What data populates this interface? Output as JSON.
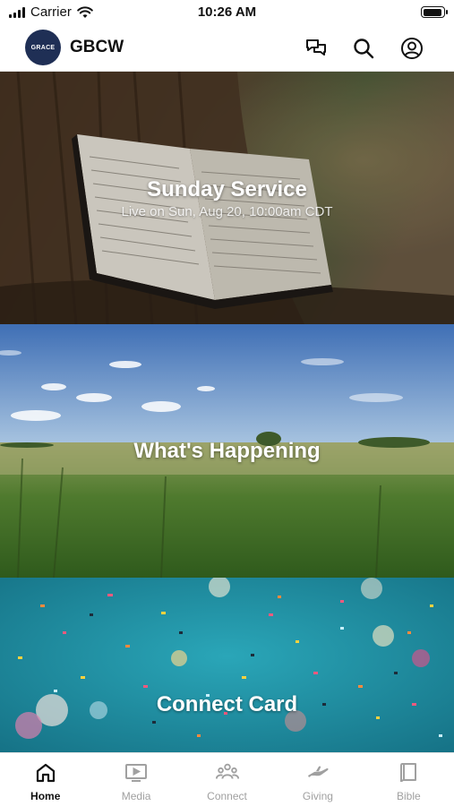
{
  "status_bar": {
    "carrier": "Carrier",
    "time": "10:26 AM"
  },
  "header": {
    "logo_text": "GRACE",
    "title": "GBCW",
    "icons": [
      "chat-icon",
      "search-icon",
      "account-icon"
    ]
  },
  "cards": [
    {
      "title": "Sunday Service",
      "subtitle": "Live on Sun, Aug 20, 10:00am CDT",
      "image": "open-bible-on-tree-stump"
    },
    {
      "title": "What's Happening",
      "image": "green-field-under-blue-sky"
    },
    {
      "title": "Connect Card",
      "image": "confetti-on-teal"
    }
  ],
  "tabs": [
    {
      "label": "Home",
      "icon": "home-icon",
      "active": true
    },
    {
      "label": "Media",
      "icon": "media-icon",
      "active": false
    },
    {
      "label": "Connect",
      "icon": "connect-icon",
      "active": false
    },
    {
      "label": "Giving",
      "icon": "giving-icon",
      "active": false
    },
    {
      "label": "Bible",
      "icon": "bible-icon",
      "active": false
    }
  ],
  "colors": {
    "logo_bg": "#1f2f55",
    "tab_active": "#111111",
    "tab_inactive": "#a0a0a0"
  }
}
